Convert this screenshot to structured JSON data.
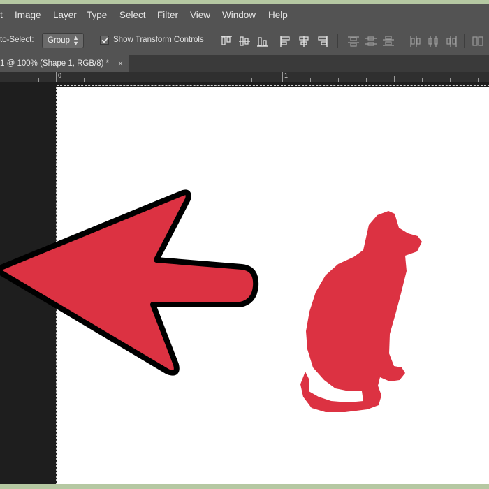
{
  "menu": {
    "items": [
      "t",
      "Image",
      "Layer",
      "Type",
      "Select",
      "Filter",
      "View",
      "Window",
      "Help"
    ]
  },
  "options_bar": {
    "auto_select_label": "to-Select:",
    "auto_select_value": "Group",
    "show_transform_label": "Show Transform Controls",
    "show_transform_checked": true
  },
  "document_tab": {
    "title": "1 @ 100% (Shape 1, RGB/8) *",
    "close_label": "×"
  },
  "ruler": {
    "labels": [
      "0",
      "1"
    ]
  },
  "canvas": {
    "shape_color": "#dc3242",
    "shapes": [
      "arrow-shape",
      "cat-silhouette"
    ]
  },
  "annotation": {
    "arrow_color": "#dc3242",
    "arrow_outline": "#000000"
  }
}
